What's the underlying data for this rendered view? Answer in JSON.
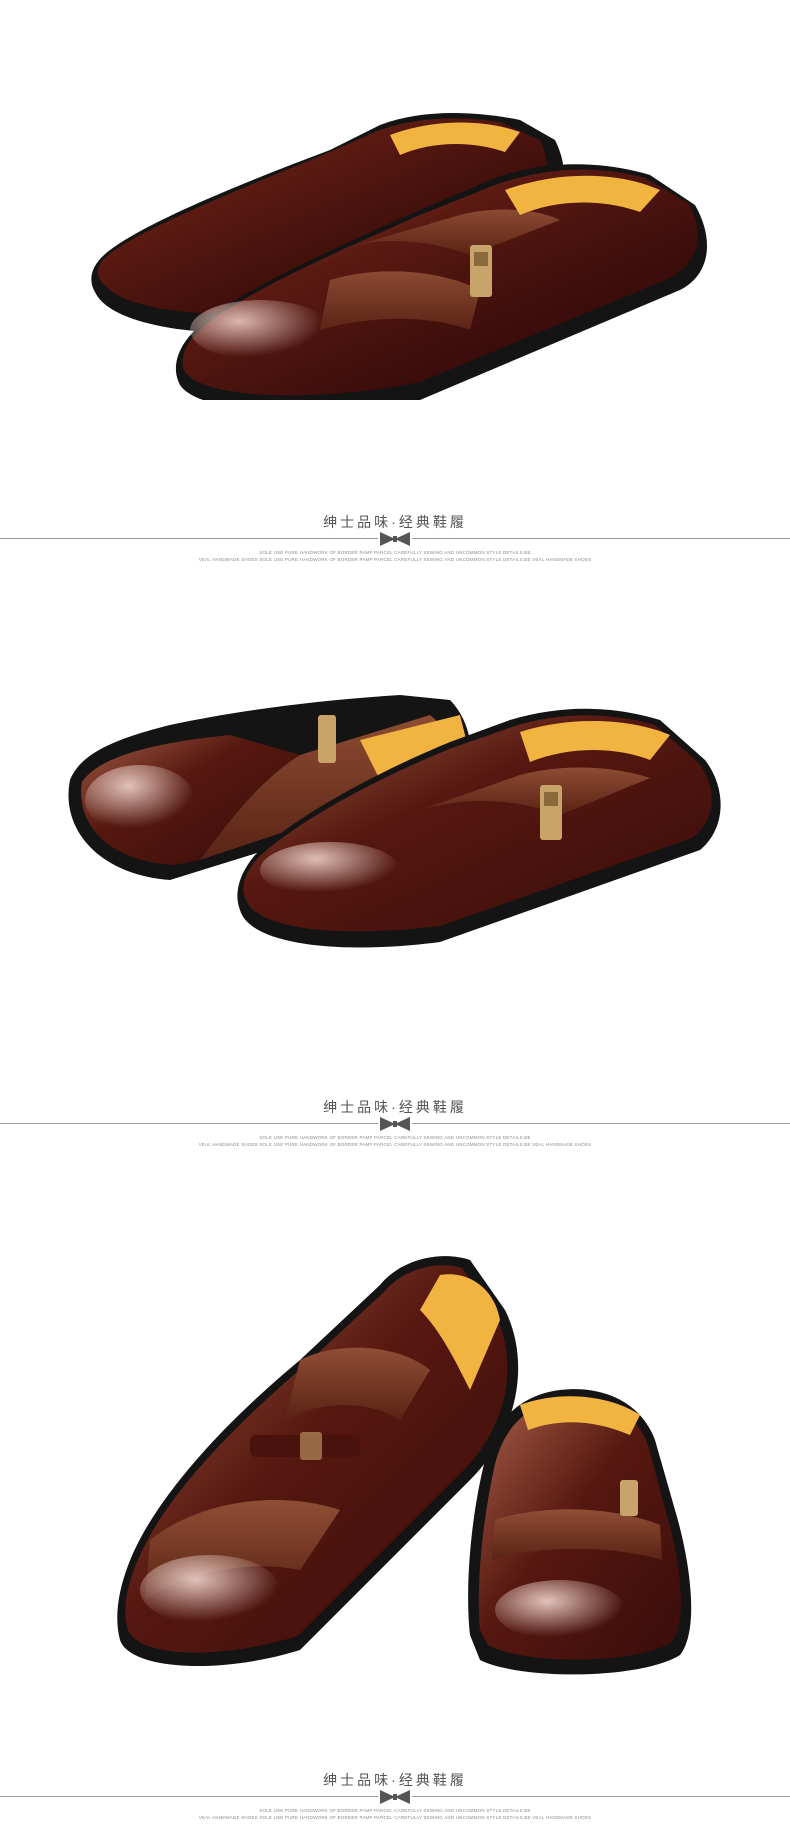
{
  "dividers": [
    {
      "title": "绅士品味·经典鞋履",
      "subtitle_line1": "SOLE USE PURE HANDWORK OF BORDER PAMP PARCEL CAREFULLY SEWING AND UNCOMMON STYLE DETAILS.BE",
      "subtitle_line2": "VEAL HANDMADE SHOES SOLE USE PURE HANDWORK OF BORDER PAMP PARCEL CAREFULLY SEWING AND UNCOMMON STYLE DETAILS.BE VEAL HANDMADE SHOES"
    },
    {
      "title": "绅士品味·经典鞋履",
      "subtitle_line1": "SOLE USE PURE HANDWORK OF BORDER PAMP PARCEL CAREFULLY SEWING AND UNCOMMON STYLE DETAILS.BE",
      "subtitle_line2": "VEAL HANDMADE SHOES SOLE USE PURE HANDWORK OF BORDER PAMP PARCEL CAREFULLY SEWING AND UNCOMMON STYLE DETAILS.BE VEAL HANDMADE SHOES"
    },
    {
      "title": "绅士品味·经典鞋履",
      "subtitle_line1": "SOLE USE PURE HANDWORK OF BORDER PAMP PARCEL CAREFULLY SEWING AND UNCOMMON STYLE DETAILS.BE",
      "subtitle_line2": "VEAL HANDMADE SHOES SOLE USE PURE HANDWORK OF BORDER PAMP PARCEL CAREFULLY SEWING AND UNCOMMON STYLE DETAILS.BE VEAL HANDMADE SHOES"
    }
  ],
  "colors": {
    "leather_dark": "#3a0f0c",
    "leather_mid": "#6b2a1c",
    "leather_light": "#a65a3d",
    "lining": "#f2b441",
    "sole": "#141414",
    "buckle": "#c9a46a",
    "rule": "#9a9a9a",
    "caption": "#555555"
  },
  "icons": [
    "bow-tie-icon"
  ]
}
